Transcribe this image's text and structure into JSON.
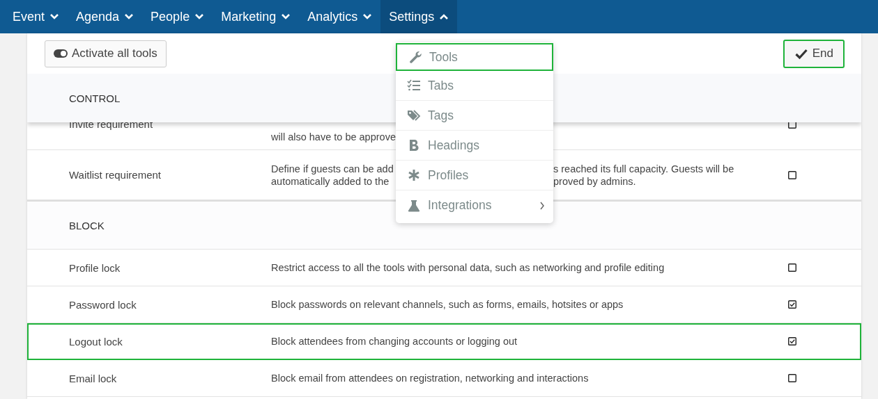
{
  "nav": [
    {
      "label": "Event",
      "expanded": false
    },
    {
      "label": "Agenda",
      "expanded": false
    },
    {
      "label": "People",
      "expanded": false
    },
    {
      "label": "Marketing",
      "expanded": false
    },
    {
      "label": "Analytics",
      "expanded": false
    },
    {
      "label": "Settings",
      "expanded": true
    }
  ],
  "toolbar": {
    "activate_button": "Activate all tools",
    "end_button": {
      "label": "End",
      "highlighted": true
    }
  },
  "sticky_section": "CONTROL",
  "sections": [
    {
      "rows": [
        {
          "kind": "partial",
          "label": "Invite requirement",
          "description_lines": [
            [
              "will also have to be approve"
            ]
          ],
          "checked": false,
          "highlighted": false
        },
        {
          "kind": "full",
          "label": "Waitlist requirement",
          "description_lines": [
            [
              "Define if guests can be add",
              "s reached its full capacity. Guests will be"
            ],
            [
              "automatically added to the",
              "proved by admins."
            ]
          ],
          "checked": false,
          "highlighted": false
        }
      ]
    },
    {
      "title": "BLOCK",
      "rows": [
        {
          "kind": "full",
          "label": "Profile lock",
          "description_lines": [
            [
              "Restrict access to all the tools with personal data, such as networking and profile editing"
            ]
          ],
          "checked": false,
          "highlighted": false
        },
        {
          "kind": "full",
          "label": "Password lock",
          "description_lines": [
            [
              "Block passwords on relevant channels, such as forms, emails, hotsites or apps"
            ]
          ],
          "checked": true,
          "highlighted": false
        },
        {
          "kind": "full",
          "label": "Logout lock",
          "description_lines": [
            [
              "Block attendees from changing accounts or logging out"
            ]
          ],
          "checked": true,
          "highlighted": true
        },
        {
          "kind": "full",
          "label": "Email lock",
          "description_lines": [
            [
              "Block email from attendees on registration, networking and interactions"
            ]
          ],
          "checked": false,
          "highlighted": false
        }
      ]
    }
  ],
  "settings_menu": [
    {
      "label": "Tools",
      "submenu": false,
      "highlighted": true
    },
    {
      "label": "Tabs",
      "submenu": false,
      "highlighted": false
    },
    {
      "label": "Tags",
      "submenu": false,
      "highlighted": false
    },
    {
      "label": "Headings",
      "submenu": false,
      "highlighted": false
    },
    {
      "label": "Profiles",
      "submenu": false,
      "highlighted": false
    },
    {
      "label": "Integrations",
      "submenu": true,
      "highlighted": false
    }
  ]
}
